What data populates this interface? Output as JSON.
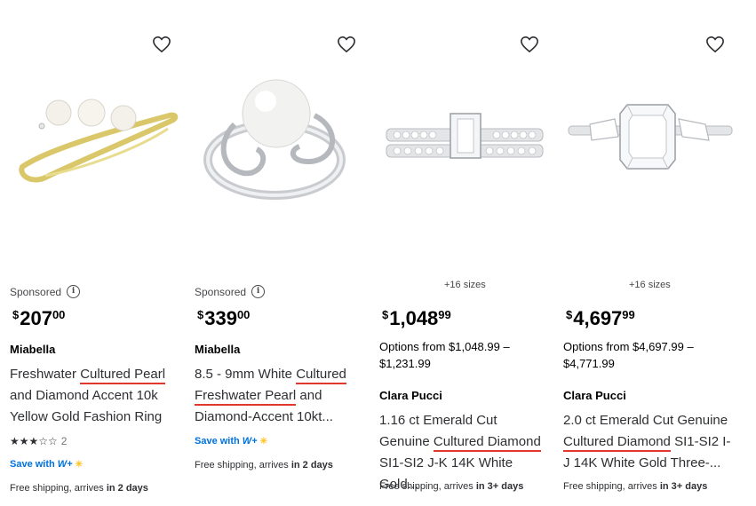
{
  "products": [
    {
      "sponsored": "Sponsored",
      "price": {
        "currency": "$",
        "dollars": "207",
        "cents": "00"
      },
      "brand": "Miabella",
      "title_parts": [
        "Freshwater ",
        "Cultured Pearl",
        " and Diamond Accent 10k Yellow Gold Fashion Ring"
      ],
      "rating": {
        "stars": 3,
        "max": 5,
        "count": "2"
      },
      "save_with": "Save with",
      "w_plus": "W+",
      "shipping": {
        "text": "Free shipping, arrives ",
        "bold": "in 2 days"
      }
    },
    {
      "sponsored": "Sponsored",
      "price": {
        "currency": "$",
        "dollars": "339",
        "cents": "00"
      },
      "brand": "Miabella",
      "title_parts": [
        "8.5 - 9mm White ",
        "Cultured",
        " ",
        "Freshwater Pearl",
        " and Diamond-Accent 10kt..."
      ],
      "save_with": "Save with",
      "w_plus": "W+",
      "shipping": {
        "text": "Free shipping, arrives ",
        "bold": "in 2 days"
      }
    },
    {
      "sizes": "+16 sizes",
      "price": {
        "currency": "$",
        "dollars": "1,048",
        "cents": "99"
      },
      "options": "Options from $1,048.99 – $1,231.99",
      "brand": "Clara Pucci",
      "title_parts": [
        "1.16 ct Emerald Cut Genuine ",
        "Cultured Diamond",
        " SI1-SI2 J-K 14K White Gold..."
      ],
      "shipping": {
        "text": "Free shipping, arrives ",
        "bold": "in 3+ days"
      }
    },
    {
      "sizes": "+16 sizes",
      "price": {
        "currency": "$",
        "dollars": "4,697",
        "cents": "99"
      },
      "options": "Options from $4,697.99 – $4,771.99",
      "brand": "Clara Pucci",
      "title_parts": [
        "2.0 ct Emerald Cut Genuine ",
        "Cultured Diamond",
        " SI1-SI2 I-J 14K White Gold Three-..."
      ],
      "shipping": {
        "text": "Free shipping, arrives ",
        "bold": "in 3+ days"
      }
    }
  ],
  "icons": {
    "favorite": "heart-outline-icon",
    "info": "info-icon"
  },
  "colors": {
    "underline": "#e1372c",
    "link": "#0071dc",
    "spark": "#ffc220"
  }
}
